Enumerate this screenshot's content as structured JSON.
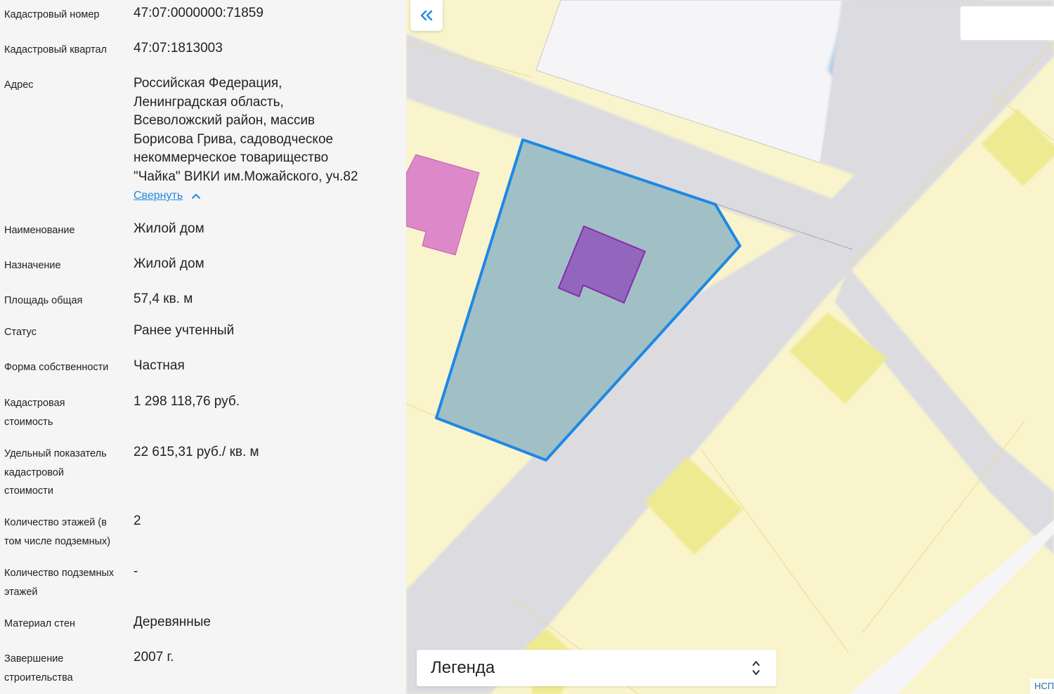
{
  "properties": [
    {
      "label": "Кадастровый номер",
      "value": "47:07:0000000:71859"
    },
    {
      "label": "Кадастровый квартал",
      "value": "47:07:1813003"
    },
    {
      "label": "Адрес",
      "value": "Российская Федерация,\nЛенинградская область,\nВсеволожский район, массив\nБорисова Грива, садоводческое\nнекоммерческое товарищество\n\"Чайка\" ВИКИ им.Можайского, уч.82"
    },
    {
      "label": "Наименование",
      "value": "Жилой дом"
    },
    {
      "label": "Назначение",
      "value": "Жилой дом"
    },
    {
      "label": "Площадь общая",
      "value": "57,4 кв. м"
    },
    {
      "label": "Статус",
      "value": "Ранее учтенный"
    },
    {
      "label": "Форма собственности",
      "value": "Частная"
    },
    {
      "label": "Кадастровая\nстоимость",
      "value": "1 298 118,76 руб."
    },
    {
      "label": "Удельный показатель\nкадастровой\nстоимости",
      "value": "22 615,31 руб./ кв. м"
    },
    {
      "label": "Количество этажей (в\nтом числе подземных)",
      "value": "2"
    },
    {
      "label": "Количество подземных\nэтажей",
      "value": "-"
    },
    {
      "label": "Материал стен",
      "value": "Деревянные"
    },
    {
      "label": "Завершение\nстроительства",
      "value": "2007 г."
    }
  ],
  "collapse_link": "Свернуть",
  "map": {
    "collapse_button_icon": "double-chevron-left-icon",
    "legend_label": "Легенда",
    "legend_icon": "chevron-up-down-icon",
    "attribution": "НСП",
    "colors": {
      "land_background": "#faf4cc",
      "road": "#dcdce0",
      "selected_parcel_fill": "#a0c0c6",
      "selected_parcel_stroke": "#1e88e5",
      "selected_building": "#9266bd",
      "other_building": "#dd88c9",
      "house_footprint": "#eeea91",
      "water": "#b0c7e4",
      "plot_white": "#f5f5f8"
    }
  }
}
